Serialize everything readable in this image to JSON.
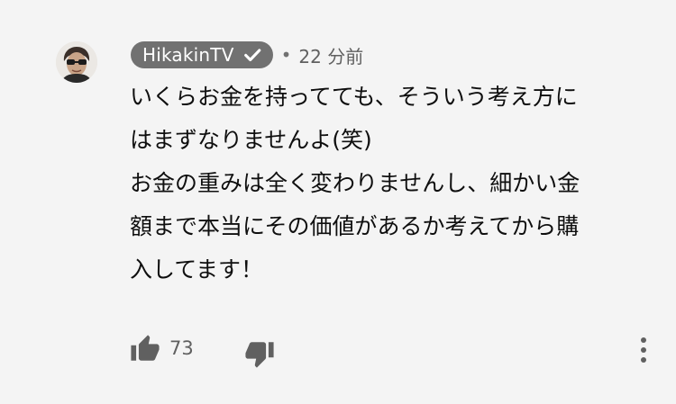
{
  "comment": {
    "author": "HikakinTV",
    "author_verified": true,
    "separator": "•",
    "timestamp": "22 分前",
    "text_lines": [
      "いくらお金を持ってても、そういう考え方に",
      "はまずなりませんよ(笑)",
      "お金の重みは全く変わりませんし、細かい金",
      "額まで本当にその価値があるか考えてから購",
      "入してます！"
    ],
    "like_count": "73"
  },
  "icons": {
    "avatar": "avatar",
    "verified": "verified-check-icon",
    "like": "thumbs-up-icon",
    "dislike": "thumbs-down-icon",
    "more": "more-vertical-icon"
  },
  "colors": {
    "background": "#f4f4f4",
    "badge": "#717171",
    "text": "#0f0f0f",
    "secondary_text": "#606060",
    "icon": "#606060"
  }
}
